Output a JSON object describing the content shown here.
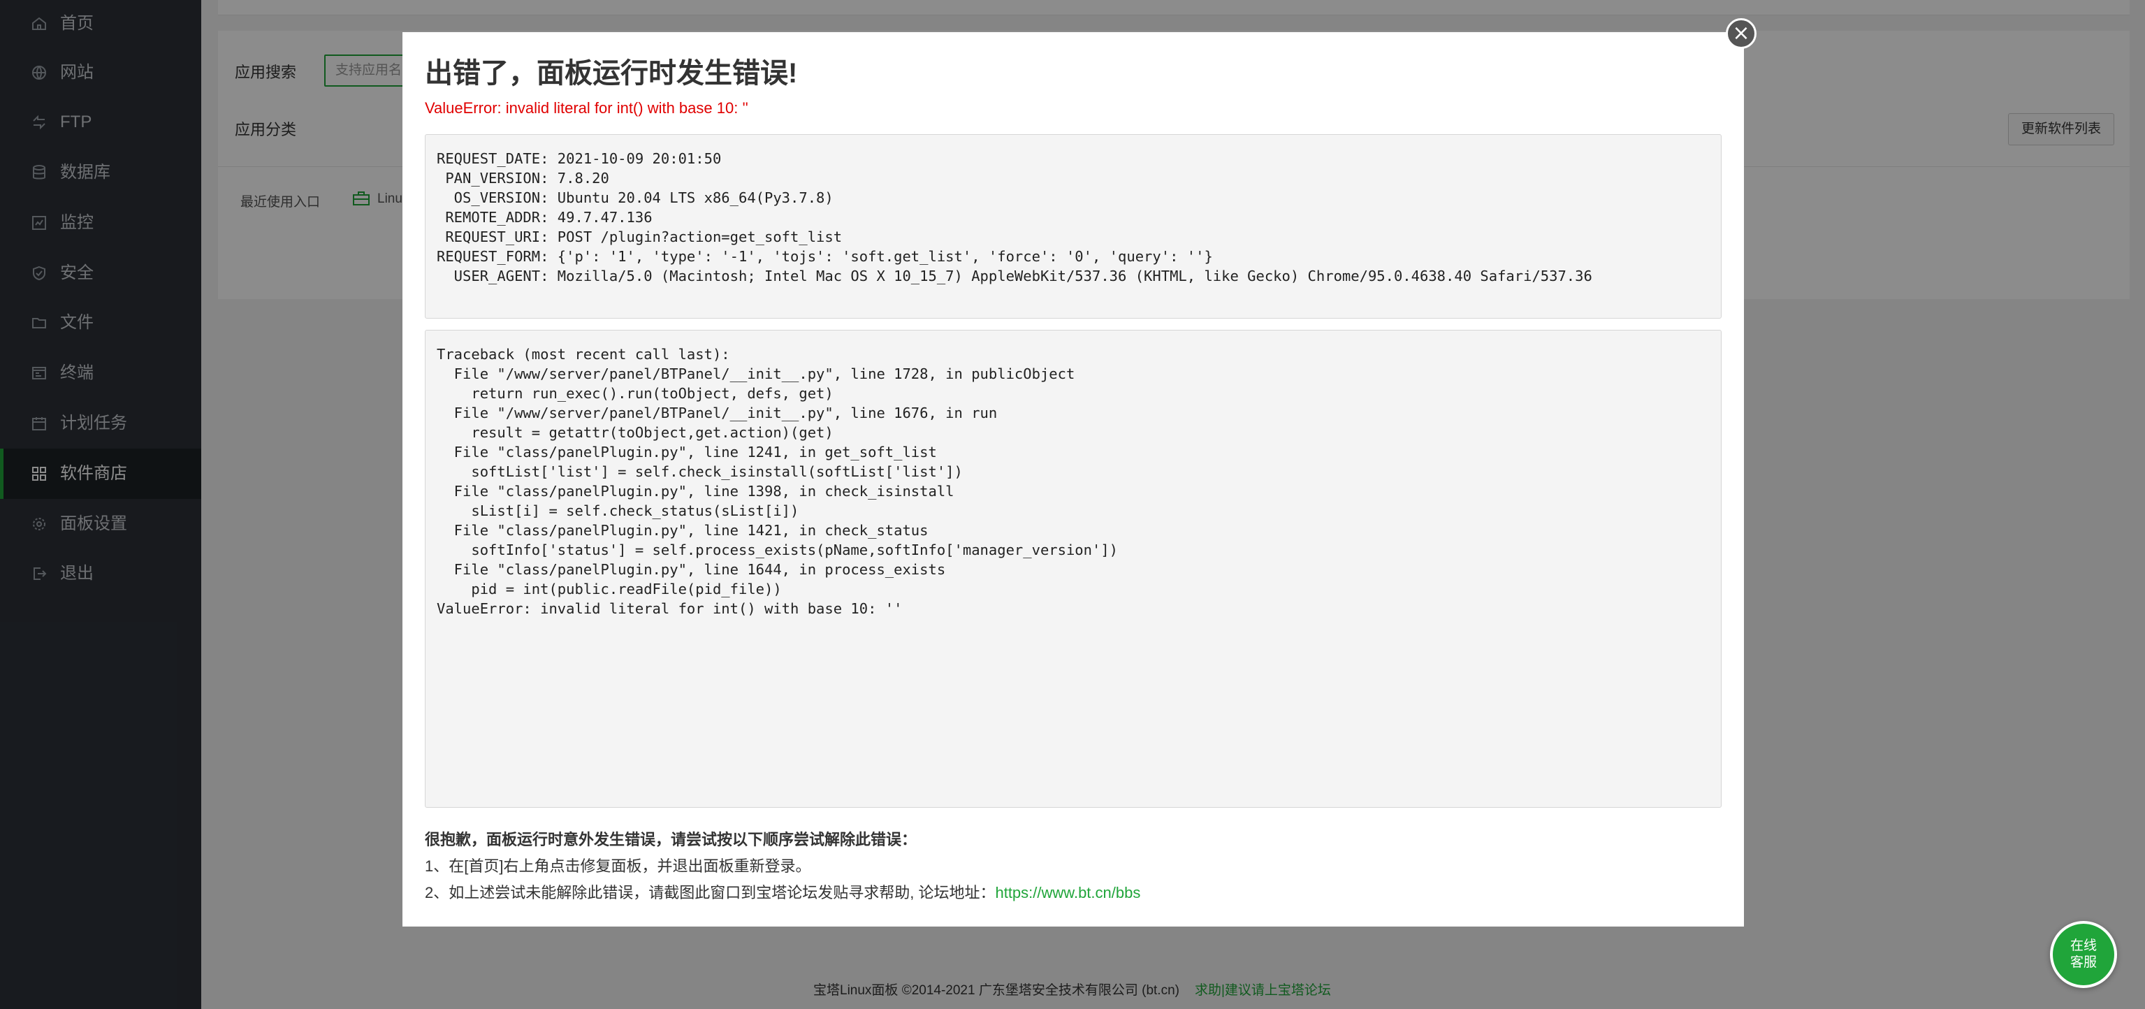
{
  "sidebar": {
    "items": [
      {
        "label": "首页",
        "icon": "home-icon"
      },
      {
        "label": "网站",
        "icon": "globe-icon"
      },
      {
        "label": "FTP",
        "icon": "ftp-icon"
      },
      {
        "label": "数据库",
        "icon": "database-icon"
      },
      {
        "label": "监控",
        "icon": "monitor-icon"
      },
      {
        "label": "安全",
        "icon": "shield-icon"
      },
      {
        "label": "文件",
        "icon": "folder-icon"
      },
      {
        "label": "终端",
        "icon": "terminal-icon"
      },
      {
        "label": "计划任务",
        "icon": "calendar-icon"
      },
      {
        "label": "软件商店",
        "icon": "apps-grid-icon",
        "active": true
      },
      {
        "label": "面板设置",
        "icon": "gear-icon"
      },
      {
        "label": "退出",
        "icon": "logout-icon"
      }
    ]
  },
  "store": {
    "search_label": "应用搜索",
    "search_placeholder": "支持应用名",
    "category_label": "应用分类",
    "refresh_button": "更新软件列表",
    "recent_label": "最近使用入口",
    "recent_item": "Linux"
  },
  "modal": {
    "title": "出错了，面板运行时发生错误!",
    "error_line": "ValueError: invalid literal for int() with base 10: ''",
    "info_lines": [
      "REQUEST_DATE: 2021-10-09 20:01:50",
      " PAN_VERSION: 7.8.20",
      "  OS_VERSION: Ubuntu 20.04 LTS x86_64(Py3.7.8)",
      " REMOTE_ADDR: 49.7.47.136",
      " REQUEST_URI: POST /plugin?action=get_soft_list",
      "REQUEST_FORM: {'p': '1', 'type': '-1', 'tojs': 'soft.get_list', 'force': '0', 'query': ''}",
      "  USER_AGENT: Mozilla/5.0 (Macintosh; Intel Mac OS X 10_15_7) AppleWebKit/537.36 (KHTML, like Gecko) Chrome/95.0.4638.40 Safari/537.36"
    ],
    "traceback_lines": [
      "Traceback (most recent call last):",
      "  File \"/www/server/panel/BTPanel/__init__.py\", line 1728, in publicObject",
      "    return run_exec().run(toObject, defs, get)",
      "  File \"/www/server/panel/BTPanel/__init__.py\", line 1676, in run",
      "    result = getattr(toObject,get.action)(get)",
      "  File \"class/panelPlugin.py\", line 1241, in get_soft_list",
      "    softList['list'] = self.check_isinstall(softList['list'])",
      "  File \"class/panelPlugin.py\", line 1398, in check_isinstall",
      "    sList[i] = self.check_status(sList[i])",
      "  File \"class/panelPlugin.py\", line 1421, in check_status",
      "    softInfo['status'] = self.process_exists(pName,softInfo['manager_version'])",
      "  File \"class/panelPlugin.py\", line 1644, in process_exists",
      "    pid = int(public.readFile(pid_file))",
      "ValueError: invalid literal for int() with base 10: ''"
    ],
    "help_title": "很抱歉，面板运行时意外发生错误，请尝试按以下顺序尝试解除此错误：",
    "help_step1": "1、在[首页]右上角点击修复面板，并退出面板重新登录。",
    "help_step2": "2、如上述尝试未能解除此错误，请截图此窗口到宝塔论坛发贴寻求帮助, 论坛地址：",
    "help_link": "https://www.bt.cn/bbs",
    "close_icon": "close-icon"
  },
  "footer": {
    "copyright": "宝塔Linux面板 ©2014-2021 广东堡塔安全技术有限公司 (bt.cn)",
    "forum_link": "求助|建议请上宝塔论坛"
  },
  "support": {
    "line1": "在线",
    "line2": "客服"
  },
  "colors": {
    "accent": "#20a53a",
    "sidebar_bg": "#2c3138",
    "error": "#e00000"
  }
}
